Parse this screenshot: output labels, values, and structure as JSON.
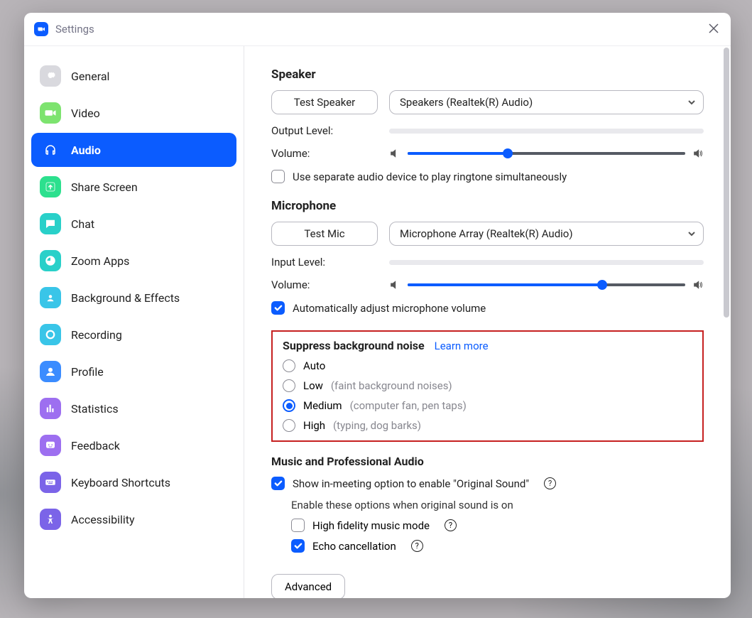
{
  "window": {
    "title": "Settings"
  },
  "sidebar": {
    "items": [
      {
        "label": "General"
      },
      {
        "label": "Video"
      },
      {
        "label": "Audio"
      },
      {
        "label": "Share Screen"
      },
      {
        "label": "Chat"
      },
      {
        "label": "Zoom Apps"
      },
      {
        "label": "Background & Effects"
      },
      {
        "label": "Recording"
      },
      {
        "label": "Profile"
      },
      {
        "label": "Statistics"
      },
      {
        "label": "Feedback"
      },
      {
        "label": "Keyboard Shortcuts"
      },
      {
        "label": "Accessibility"
      }
    ]
  },
  "speaker": {
    "heading": "Speaker",
    "test_label": "Test Speaker",
    "device": "Speakers (Realtek(R) Audio)",
    "output_label": "Output Level:",
    "volume_label": "Volume:",
    "separate_device_label": "Use separate audio device to play ringtone simultaneously"
  },
  "microphone": {
    "heading": "Microphone",
    "test_label": "Test Mic",
    "device": "Microphone Array (Realtek(R) Audio)",
    "input_label": "Input Level:",
    "volume_label": "Volume:",
    "auto_adjust_label": "Automatically adjust microphone volume"
  },
  "noise": {
    "heading": "Suppress background noise",
    "learn_more": "Learn more",
    "options": [
      {
        "label": "Auto",
        "hint": ""
      },
      {
        "label": "Low",
        "hint": "(faint background noises)"
      },
      {
        "label": "Medium",
        "hint": "(computer fan, pen taps)"
      },
      {
        "label": "High",
        "hint": "(typing, dog barks)"
      }
    ],
    "selected": "Medium"
  },
  "music": {
    "heading": "Music and Professional Audio",
    "original_sound_label": "Show in-meeting option to enable \"Original Sound\"",
    "enable_hint": "Enable these options when original sound is on",
    "hifi_label": "High fidelity music mode",
    "echo_label": "Echo cancellation"
  },
  "advanced_label": "Advanced"
}
